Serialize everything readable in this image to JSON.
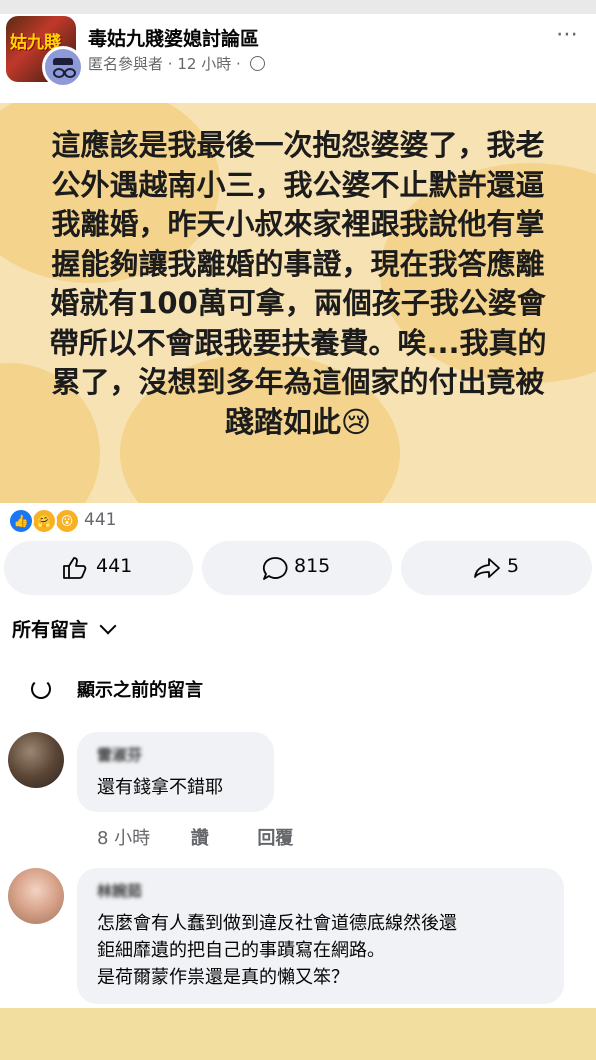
{
  "header": {
    "group_name": "毒姑九賤婆媳討論區",
    "group_thumb_text": "姑九賤",
    "author": "匿名參與者",
    "time": "12 小時",
    "more_icon": "⋯"
  },
  "post": {
    "lines": [
      "這應該是我最後一次抱怨婆婆了，我老",
      "公外遇越南小三，我公婆不止默許還逼",
      "我離婚，昨天小叔來家裡跟我說他有掌",
      "握能夠讓我離婚的事證，現在我答應離",
      "婚就有100萬可拿，兩個孩子我公婆會",
      "帶所以不會跟我要扶養費。唉...我真的",
      "累了，沒想到多年為這個家的付出竟被",
      "踐踏如此😢"
    ],
    "background_color": "#f7e2b3",
    "accent_color": "#f3c96e"
  },
  "reactions": {
    "icons": [
      "like-icon",
      "care-icon",
      "wow-icon"
    ],
    "count": "441"
  },
  "actions": {
    "like_count": "441",
    "comment_count": "815",
    "share_count": "5"
  },
  "comments_section": {
    "sort_label": "所有留言",
    "view_previous": "顯示之前的留言"
  },
  "comments": [
    {
      "name": "雷淑芬",
      "text": "還有錢拿不錯耶",
      "time": "8 小時",
      "like_label": "讚",
      "reply_label": "回覆"
    },
    {
      "name": "林婉茹",
      "lines": [
        "怎麼會有人蠢到做到違反社會道德底線然後還",
        "鉅細靡遺的把自己的事蹟寫在網路。",
        "是荷爾蒙作祟還是真的懶又笨？"
      ]
    }
  ]
}
